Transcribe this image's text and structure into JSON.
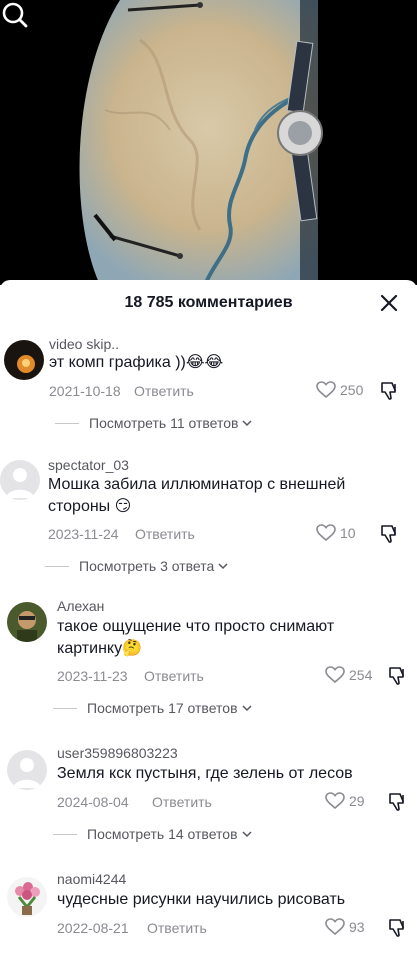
{
  "sheet": {
    "title": "18 785 комментариев"
  },
  "labels": {
    "reply": "Ответить"
  },
  "colors": {
    "text": "#161823",
    "secondary": "#8a8b91",
    "username": "#57585f"
  },
  "comments": [
    {
      "username": "video skip..",
      "text": "эт комп графика ))😂😂",
      "date": "2021-10-18",
      "likes": "250",
      "view_replies": "Посмотреть 11 ответов",
      "avatar": "dark-orange-avatar"
    },
    {
      "username": "spectator_03",
      "text": "Мошка забила иллюминатор с внешней стороны 😏",
      "date": "2023-11-24",
      "likes": "10",
      "view_replies": "Посмотреть 3 ответа",
      "avatar": "default-avatar"
    },
    {
      "username": "Алехан",
      "text": "такое ощущение что просто снимают картинку🤔",
      "date": "2023-11-23",
      "likes": "254",
      "view_replies": "Посмотреть 17 ответов",
      "avatar": "photo-avatar"
    },
    {
      "username": "user359896803223",
      "text": "Земля кск пустыня, где зелень от лесов",
      "date": "2024-08-04",
      "likes": "29",
      "view_replies": "Посмотреть 14 ответов",
      "avatar": "default-avatar"
    },
    {
      "username": "naomi4244",
      "text": "чудесные рисунки научились рисовать",
      "date": "2022-08-21",
      "likes": "93",
      "view_replies": "",
      "avatar": "flower-avatar"
    }
  ]
}
